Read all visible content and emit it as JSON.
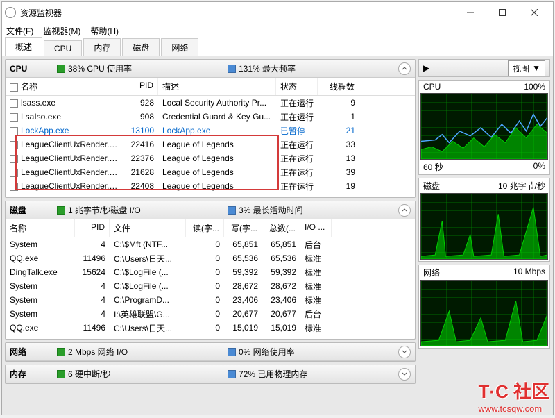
{
  "window": {
    "title": "资源监视器"
  },
  "menu": {
    "file": "文件(F)",
    "monitor": "监视器(M)",
    "help": "帮助(H)"
  },
  "tabs": [
    "概述",
    "CPU",
    "内存",
    "磁盘",
    "网络"
  ],
  "cpu_panel": {
    "title": "CPU",
    "stat1": "38% CPU 使用率",
    "stat2": "131% 最大频率",
    "cols": {
      "name": "名称",
      "pid": "PID",
      "desc": "描述",
      "status": "状态",
      "threads": "线程数"
    },
    "rows": [
      {
        "name": "lsass.exe",
        "pid": "928",
        "desc": "Local Security Authority Pr...",
        "status": "正在运行",
        "threads": "9",
        "blue": false
      },
      {
        "name": "LsaIso.exe",
        "pid": "908",
        "desc": "Credential Guard & Key Gu...",
        "status": "正在运行",
        "threads": "1",
        "blue": false
      },
      {
        "name": "LockApp.exe",
        "pid": "13100",
        "desc": "LockApp.exe",
        "status": "已暂停",
        "threads": "21",
        "blue": true
      },
      {
        "name": "LeagueClientUxRender.exe",
        "pid": "22416",
        "desc": "League of Legends",
        "status": "正在运行",
        "threads": "33",
        "blue": false
      },
      {
        "name": "LeagueClientUxRender.exe",
        "pid": "22376",
        "desc": "League of Legends",
        "status": "正在运行",
        "threads": "13",
        "blue": false
      },
      {
        "name": "LeagueClientUxRender.exe",
        "pid": "21628",
        "desc": "League of Legends",
        "status": "正在运行",
        "threads": "39",
        "blue": false
      },
      {
        "name": "LeagueClientUxRender.exe",
        "pid": "22408",
        "desc": "League of Legends",
        "status": "正在运行",
        "threads": "19",
        "blue": false
      }
    ]
  },
  "disk_panel": {
    "title": "磁盘",
    "stat1": "1 兆字节/秒磁盘 I/O",
    "stat2": "3% 最长活动时间",
    "cols": {
      "name": "名称",
      "pid": "PID",
      "file": "文件",
      "read": "读(字...",
      "write": "写(字...",
      "total": "总数(...",
      "io": "I/O ..."
    },
    "rows": [
      {
        "name": "System",
        "pid": "4",
        "file": "C:\\$Mft (NTF...",
        "read": "0",
        "write": "65,851",
        "total": "65,851",
        "io": "后台"
      },
      {
        "name": "QQ.exe",
        "pid": "11496",
        "file": "C:\\Users\\日天...",
        "read": "0",
        "write": "65,536",
        "total": "65,536",
        "io": "标准"
      },
      {
        "name": "DingTalk.exe",
        "pid": "15624",
        "file": "C:\\$LogFile (...",
        "read": "0",
        "write": "59,392",
        "total": "59,392",
        "io": "标准"
      },
      {
        "name": "System",
        "pid": "4",
        "file": "C:\\$LogFile (...",
        "read": "0",
        "write": "28,672",
        "total": "28,672",
        "io": "标准"
      },
      {
        "name": "System",
        "pid": "4",
        "file": "C:\\ProgramD...",
        "read": "0",
        "write": "23,406",
        "total": "23,406",
        "io": "标准"
      },
      {
        "name": "System",
        "pid": "4",
        "file": "I:\\英雄联盟\\G...",
        "read": "0",
        "write": "20,677",
        "total": "20,677",
        "io": "后台"
      },
      {
        "name": "QQ.exe",
        "pid": "11496",
        "file": "C:\\Users\\日天...",
        "read": "0",
        "write": "15,019",
        "total": "15,019",
        "io": "标准"
      }
    ]
  },
  "net_panel": {
    "title": "网络",
    "stat1": "2 Mbps 网络 I/O",
    "stat2": "0% 网络使用率"
  },
  "mem_panel": {
    "title": "内存",
    "stat1": "6 硬中断/秒",
    "stat2": "72% 已用物理内存"
  },
  "right": {
    "view_label": "视图",
    "charts": [
      {
        "title": "CPU",
        "right": "100%",
        "footer_l": "60 秒",
        "footer_r": "0%"
      },
      {
        "title": "磁盘",
        "right": "10 兆字节/秒",
        "footer_l": "",
        "footer_r": ""
      },
      {
        "title": "网络",
        "right": "10 Mbps",
        "footer_l": "",
        "footer_r": ""
      }
    ]
  },
  "watermark": {
    "main": "T·C 社区",
    "sub": "www.tcsqw.com"
  }
}
